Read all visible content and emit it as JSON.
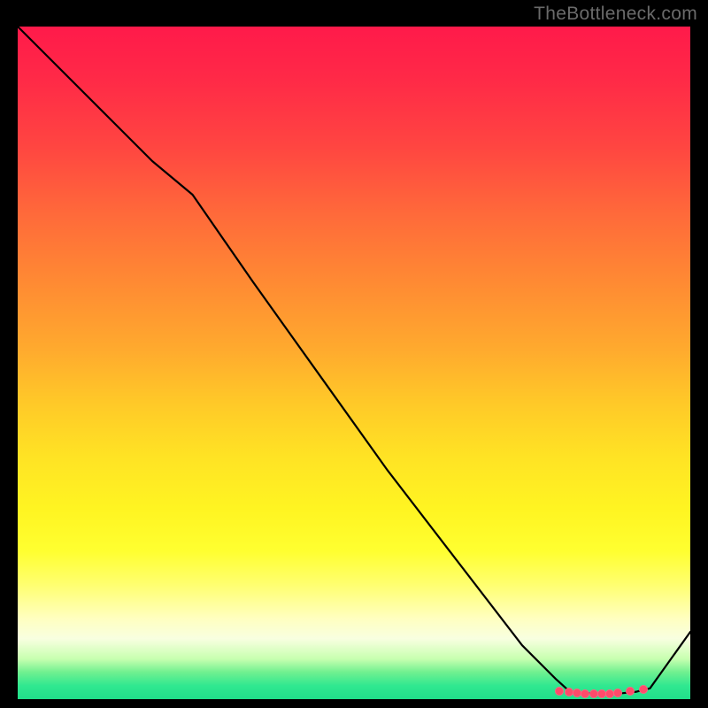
{
  "attribution": "TheBottleneck.com",
  "chart_data": {
    "type": "line",
    "title": "",
    "xlabel": "",
    "ylabel": "",
    "xlim": [
      0,
      100
    ],
    "ylim": [
      0,
      100
    ],
    "grid": false,
    "series": [
      {
        "name": "curve",
        "x": [
          0,
          10,
          20,
          26,
          35,
          45,
          55,
          65,
          75,
          80,
          82,
          84,
          86,
          88,
          90,
          92,
          94,
          100
        ],
        "y": [
          100,
          90,
          80,
          75,
          62,
          48,
          34,
          21,
          8,
          3,
          1.2,
          0.9,
          0.8,
          0.8,
          0.9,
          1.1,
          1.6,
          10
        ],
        "color": "#000000",
        "width": 2.2
      }
    ],
    "markers": {
      "color": "#ff4a6a",
      "points": [
        {
          "x": 80.5,
          "y": 1.2
        },
        {
          "x": 82.0,
          "y": 1.0
        },
        {
          "x": 83.2,
          "y": 0.9
        },
        {
          "x": 84.4,
          "y": 0.85
        },
        {
          "x": 85.6,
          "y": 0.8
        },
        {
          "x": 86.8,
          "y": 0.8
        },
        {
          "x": 88.0,
          "y": 0.85
        },
        {
          "x": 89.2,
          "y": 0.95
        },
        {
          "x": 91.0,
          "y": 1.15
        },
        {
          "x": 93.0,
          "y": 1.5
        }
      ]
    }
  }
}
